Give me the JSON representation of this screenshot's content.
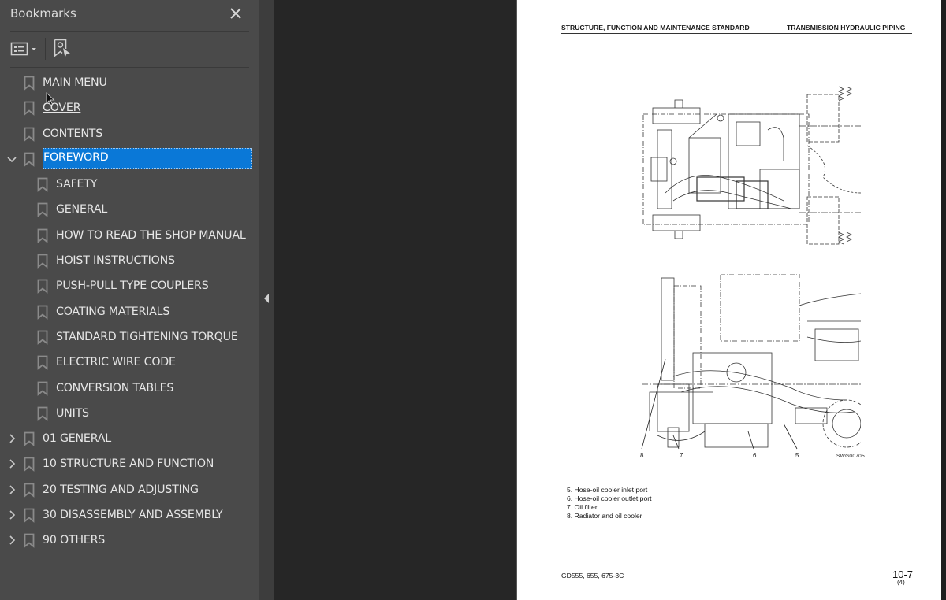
{
  "sidebar": {
    "title": "Bookmarks",
    "toolbar": {
      "options_menu": "bookmark-options-menu",
      "find_current": "find-current-bookmark"
    },
    "items": [
      {
        "label": "MAIN MENU",
        "level": 0,
        "expander": "none"
      },
      {
        "label": "COVER",
        "level": 0,
        "expander": "none",
        "hovered": true
      },
      {
        "label": "CONTENTS",
        "level": 0,
        "expander": "none"
      },
      {
        "label": "FOREWORD",
        "level": 0,
        "expander": "expanded",
        "selected": true
      },
      {
        "label": "SAFETY",
        "level": 1,
        "expander": "none"
      },
      {
        "label": "GENERAL",
        "level": 1,
        "expander": "none"
      },
      {
        "label": "HOW TO READ THE SHOP MANUAL",
        "level": 1,
        "expander": "none"
      },
      {
        "label": "HOIST INSTRUCTIONS",
        "level": 1,
        "expander": "none"
      },
      {
        "label": "PUSH-PULL TYPE COUPLERS",
        "level": 1,
        "expander": "none"
      },
      {
        "label": "COATING MATERIALS",
        "level": 1,
        "expander": "none"
      },
      {
        "label": "STANDARD TIGHTENING TORQUE",
        "level": 1,
        "expander": "none"
      },
      {
        "label": "ELECTRIC WIRE CODE",
        "level": 1,
        "expander": "none"
      },
      {
        "label": "CONVERSION TABLES",
        "level": 1,
        "expander": "none"
      },
      {
        "label": "UNITS",
        "level": 1,
        "expander": "none"
      },
      {
        "label": "01 GENERAL",
        "level": 0,
        "expander": "collapsed"
      },
      {
        "label": "10 STRUCTURE AND FUNCTION",
        "level": 0,
        "expander": "collapsed"
      },
      {
        "label": "20 TESTING AND ADJUSTING",
        "level": 0,
        "expander": "collapsed"
      },
      {
        "label": "30 DISASSEMBLY AND ASSEMBLY",
        "level": 0,
        "expander": "collapsed"
      },
      {
        "label": "90 OTHERS",
        "level": 0,
        "expander": "collapsed"
      }
    ]
  },
  "page": {
    "header_left": "STRUCTURE, FUNCTION AND MAINTENANCE STANDARD",
    "header_right": "TRANSMISSION HYDRAULIC PIPING",
    "figure_code": "SWG00705",
    "callouts": [
      "8",
      "7",
      "6",
      "5"
    ],
    "legend": [
      "5. Hose-oil cooler inlet port",
      "6. Hose-oil cooler outlet port",
      "7. Oil filter",
      "8. Radiator and oil cooler"
    ],
    "footer_model": "GD555, 655, 675-3C",
    "footer_page": "10-7",
    "footer_revision": "(4)"
  },
  "colors": {
    "sidebar_bg": "#4a4a4a",
    "selection": "#0a78d7",
    "viewer_bg": "#262626",
    "page_bg": "#ffffff"
  }
}
